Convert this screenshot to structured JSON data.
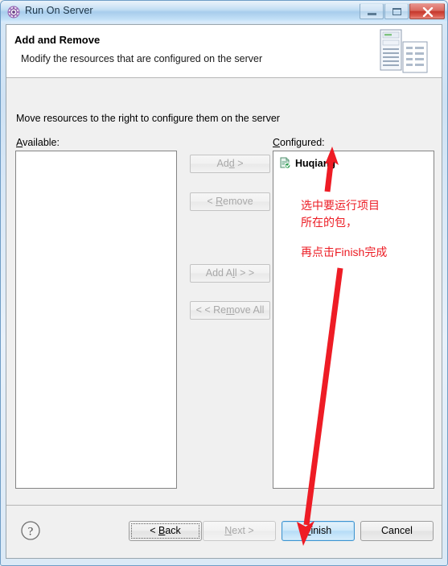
{
  "window": {
    "title": "Run On Server",
    "title_icon": "run-on-server-icon",
    "controls": {
      "minimize": "minimize-icon",
      "maximize": "maximize-icon",
      "close": "close-icon"
    }
  },
  "header": {
    "title": "Add and Remove",
    "description": "Modify the resources that are configured on the server",
    "art": "server-and-document-icon"
  },
  "body": {
    "intro": "Move resources to the right to configure them on the server",
    "available_label": "Available:",
    "available_mnemonic": "A",
    "configured_label": "Configured:",
    "configured_mnemonic": "C",
    "available_items": [],
    "configured_items": [
      {
        "label": "Huqiang",
        "icon": "web-module-icon"
      }
    ],
    "transfer_buttons": [
      {
        "id": "add",
        "pre": "Ad",
        "mnemonic": "d",
        "post": " >",
        "enabled": false
      },
      {
        "id": "remove",
        "pre": "< ",
        "mnemonic": "R",
        "post": "emove",
        "enabled": false
      },
      {
        "id": "add-all",
        "pre": "Add A",
        "mnemonic": "l",
        "post": "l > >",
        "enabled": false
      },
      {
        "id": "remove-all",
        "pre": "< < Re",
        "mnemonic": "m",
        "post": "ove All",
        "enabled": false
      }
    ]
  },
  "footer": {
    "help": "help-icon",
    "buttons": [
      {
        "id": "back",
        "pre": "< ",
        "mnemonic": "B",
        "post": "ack",
        "enabled": true,
        "focused": true,
        "default": false
      },
      {
        "id": "next",
        "pre": "",
        "mnemonic": "N",
        "post": "ext >",
        "enabled": false,
        "focused": false,
        "default": false
      },
      {
        "id": "finish",
        "pre": "",
        "mnemonic": "F",
        "post": "inish",
        "enabled": true,
        "focused": false,
        "default": true
      },
      {
        "id": "cancel",
        "pre": "Cancel",
        "mnemonic": "",
        "post": "",
        "enabled": true,
        "focused": false,
        "default": false
      }
    ]
  },
  "annotations": {
    "color": "#ec1c24",
    "note_1": "选中要运行项目\n所在的包，",
    "note_2": "再点击Finish完成",
    "arrow_1": "arrow-pointing-to-huqiang",
    "arrow_2": "arrow-pointing-to-finish"
  }
}
